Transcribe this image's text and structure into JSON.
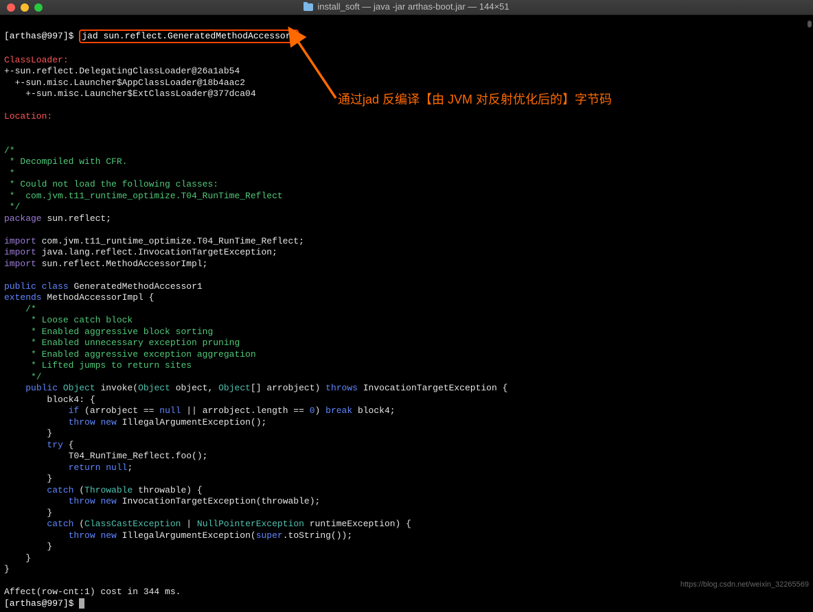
{
  "titlebar": {
    "title": "install_soft — java -jar arthas-boot.jar — 144×51"
  },
  "prompt": {
    "user": "[arthas@997]$",
    "command": "jad sun.reflect.GeneratedMethodAccessor1"
  },
  "annotation": {
    "text": "通过jad 反编译【由 JVM 对反射优化后的】字节码"
  },
  "sections": {
    "classloader": "ClassLoader:",
    "cl_lines": [
      "+-sun.reflect.DelegatingClassLoader@26a1ab54",
      "  +-sun.misc.Launcher$AppClassLoader@18b4aac2",
      "    +-sun.misc.Launcher$ExtClassLoader@377dca04"
    ],
    "location": "Location:"
  },
  "code": {
    "c_head": [
      "/*",
      " * Decompiled with CFR.",
      " *",
      " * Could not load the following classes:",
      " *  com.jvm.t11_runtime_optimize.T04_RunTime_Reflect",
      " */"
    ],
    "pkg_kw": "package",
    "pkg_name": " sun.reflect;",
    "import_kw": "import",
    "imports": [
      " com.jvm.t11_runtime_optimize.T04_RunTime_Reflect;",
      " java.lang.reflect.InvocationTargetException;",
      " sun.reflect.MethodAccessorImpl;"
    ],
    "public": "public",
    "class": "class",
    "extends": "extends",
    "classname": " GeneratedMethodAccessor1",
    "superclass": " MethodAccessorImpl {",
    "method_comment": [
      "    /*",
      "     * Loose catch block",
      "     * Enabled aggressive block sorting",
      "     * Enabled unnecessary exception pruning",
      "     * Enabled aggressive exception aggregation",
      "     * Lifted jumps to return sites",
      "     */"
    ],
    "m_public": "public",
    "m_object": "Object",
    "m_invoke": " invoke(",
    "m_param1t": "Object",
    "m_param1n": " object, ",
    "m_param2t": "Object",
    "m_param2arr": "[] arrobject) ",
    "m_throws": "throws",
    "m_exc": " InvocationTargetException {",
    "block4": "        block4: {",
    "if": "if",
    "cond_open": " (arrobject == ",
    "null": "null",
    "cond_mid": " || arrobject.length == ",
    "zero": "0",
    "cond_close": ") ",
    "break": "break",
    "break_tgt": " block4;",
    "throw": "throw",
    "new": "new",
    "iae": " IllegalArgumentException();",
    "close_brace": "        }",
    "try": "try",
    "try_open": " {",
    "foo_call": "            T04_RunTime_Reflect.foo();",
    "return": "return",
    "ret_null": " null",
    "semi": ";",
    "catch": "catch",
    "catch1_open": " (",
    "throwable_t": "Throwable",
    "throwable_n": " throwable) {",
    "ite": " InvocationTargetException(throwable);",
    "catch2_t1": "ClassCastException",
    "catch2_pipe": " | ",
    "catch2_t2": "NullPointerException",
    "catch2_n": " runtimeException) {",
    "iae2": " IllegalArgumentException(",
    "super": "super",
    "tostring": ".toString());",
    "close2": "    }",
    "close3": "}"
  },
  "footer": {
    "affect": "Affect(row-cnt:1) cost in 344 ms.",
    "prompt2": "[arthas@997]$ "
  },
  "watermark": "https://blog.csdn.net/weixin_32265569"
}
